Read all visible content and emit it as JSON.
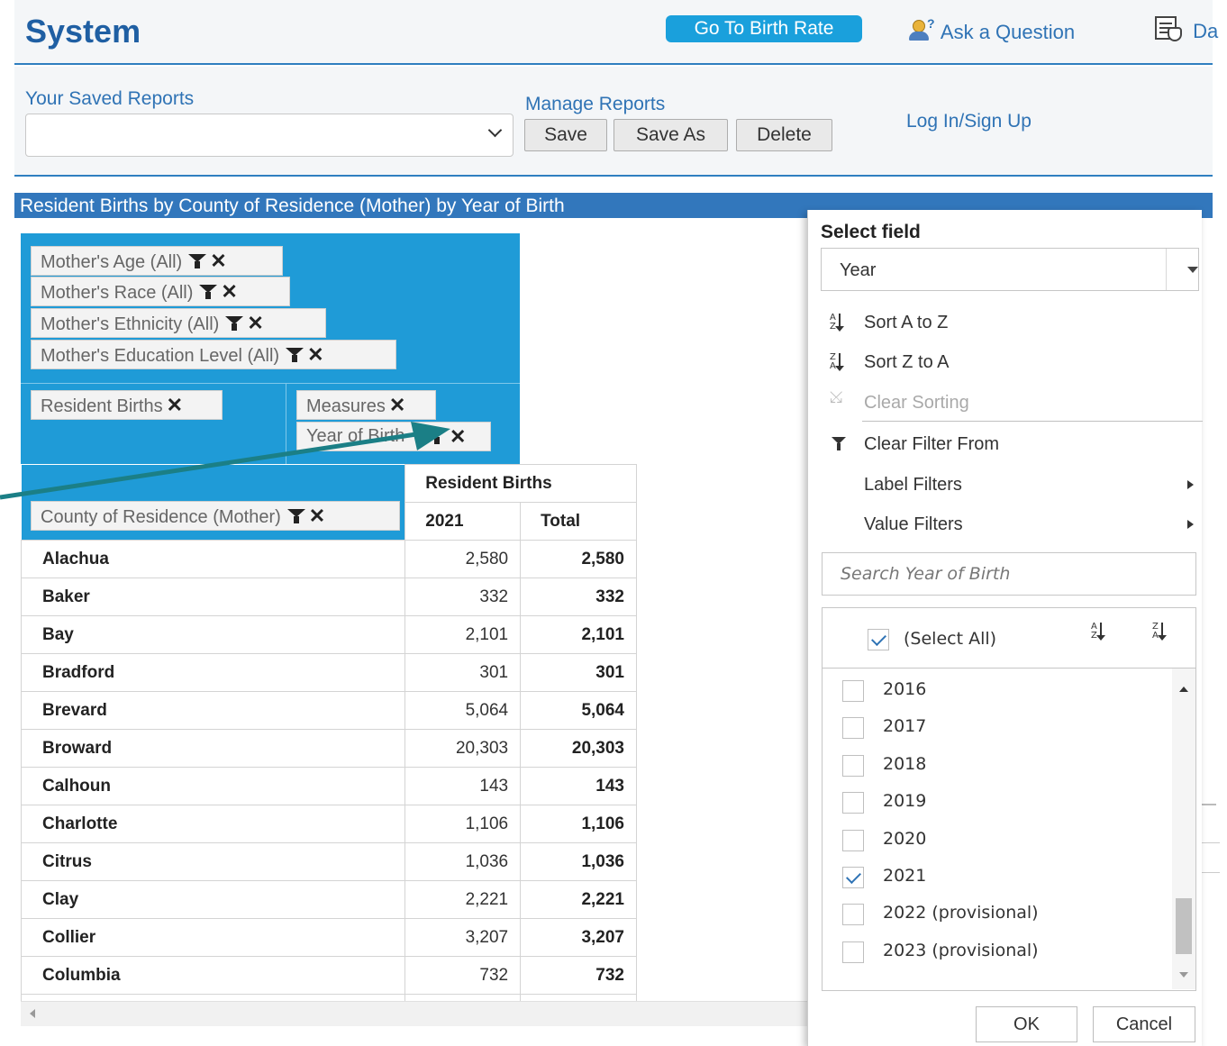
{
  "header": {
    "title": "System",
    "go_button": "Go To Birth Rate",
    "ask_link": "Ask a Question",
    "ask_icon_q": "?",
    "da_link": "Da"
  },
  "reports": {
    "saved_label": "Your Saved Reports",
    "saved_value": "",
    "manage_label": "Manage Reports",
    "save": "Save",
    "save_as": "Save As",
    "delete": "Delete",
    "login": "Log In/Sign Up"
  },
  "report_title": "Resident Births by County of Residence (Mother) by Year of Birth",
  "pivot": {
    "filters": [
      {
        "label": "Mother's Age (All)"
      },
      {
        "label": "Mother's Race (All)"
      },
      {
        "label": "Mother's Ethnicity (All)"
      },
      {
        "label": "Mother's Education Level (All)"
      }
    ],
    "values_field": "Resident Births",
    "column_fields": [
      "Measures",
      "Year of Birth"
    ],
    "row_field": "County of Residence (Mother)",
    "close_glyph": "✕"
  },
  "grid": {
    "measure_header": "Resident Births",
    "col_year": "2021",
    "col_total": "Total",
    "rows": [
      {
        "county": "Alachua",
        "value": "2,580",
        "total": "2,580"
      },
      {
        "county": "Baker",
        "value": "332",
        "total": "332"
      },
      {
        "county": "Bay",
        "value": "2,101",
        "total": "2,101"
      },
      {
        "county": "Bradford",
        "value": "301",
        "total": "301"
      },
      {
        "county": "Brevard",
        "value": "5,064",
        "total": "5,064"
      },
      {
        "county": "Broward",
        "value": "20,303",
        "total": "20,303"
      },
      {
        "county": "Calhoun",
        "value": "143",
        "total": "143"
      },
      {
        "county": "Charlotte",
        "value": "1,106",
        "total": "1,106"
      },
      {
        "county": "Citrus",
        "value": "1,036",
        "total": "1,036"
      },
      {
        "county": "Clay",
        "value": "2,221",
        "total": "2,221"
      },
      {
        "county": "Collier",
        "value": "3,207",
        "total": "3,207"
      },
      {
        "county": "Columbia",
        "value": "732",
        "total": "732"
      }
    ]
  },
  "filter_panel": {
    "title": "Select field",
    "field_value": "Year",
    "sort_az": "Sort A to Z",
    "sort_za": "Sort Z to A",
    "clear_sorting": "Clear Sorting",
    "clear_filter": "Clear Filter From",
    "label_filters": "Label Filters",
    "value_filters": "Value Filters",
    "search_placeholder": "Search Year of Birth",
    "select_all": "(Select All)",
    "select_all_checked": true,
    "years": [
      {
        "label": "2016",
        "checked": false
      },
      {
        "label": "2017",
        "checked": false
      },
      {
        "label": "2018",
        "checked": false
      },
      {
        "label": "2019",
        "checked": false
      },
      {
        "label": "2020",
        "checked": false
      },
      {
        "label": "2021",
        "checked": true
      },
      {
        "label": "2022 (provisional)",
        "checked": false
      },
      {
        "label": "2023 (provisional)",
        "checked": false
      }
    ],
    "ok": "OK",
    "cancel": "Cancel"
  },
  "colors": {
    "accent_blue": "#1f9bd7",
    "title_bar": "#3277bc",
    "callout_arrow": "#1b7f86"
  },
  "icons": [
    "person-question-icon",
    "report-hand-icon",
    "filter-icon",
    "close-icon",
    "sort-az-icon",
    "sort-za-icon",
    "clear-sort-icon",
    "clear-filter-icon",
    "submenu-arrow-icon",
    "chevron-down-icon",
    "dropdown-triangle-icon",
    "checkbox-icon",
    "callout-arrow"
  ]
}
